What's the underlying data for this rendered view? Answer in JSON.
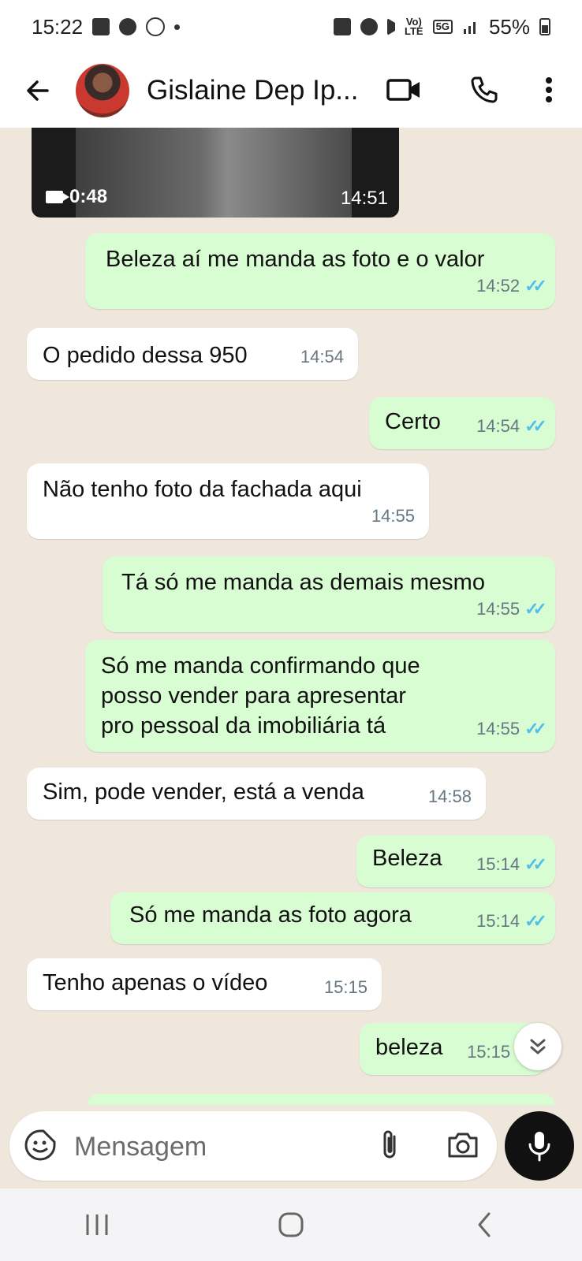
{
  "status_bar": {
    "time": "15:22",
    "network_top": "Vo)",
    "network_bottom": "LTE",
    "fiveg": "5G",
    "battery": "55%"
  },
  "header": {
    "contact_name": "Gislaine Dep Ip..."
  },
  "video_message": {
    "duration": "0:48",
    "time": "14:51"
  },
  "messages": [
    {
      "direction": "out",
      "text": "Beleza aí me manda as foto e o valor",
      "time": "14:52",
      "read": true
    },
    {
      "direction": "in",
      "text": "O pedido dessa 950",
      "time": "14:54"
    },
    {
      "direction": "out",
      "text": "Certo",
      "time": "14:54",
      "read": true
    },
    {
      "direction": "in",
      "text": "Não tenho foto da fachada aqui",
      "time": "14:55"
    },
    {
      "direction": "out",
      "text": "Tá só me manda as demais mesmo",
      "time": "14:55",
      "read": true
    },
    {
      "direction": "out",
      "text": "Só me manda confirmando que posso vender para apresentar pro pessoal da imobiliária tá",
      "time": "14:55",
      "read": true
    },
    {
      "direction": "in",
      "text": "Sim, pode vender, está a venda",
      "time": "14:58"
    },
    {
      "direction": "out",
      "text": "Beleza",
      "time": "15:14",
      "read": true
    },
    {
      "direction": "out",
      "text": "Só me manda as foto agora",
      "time": "15:14",
      "read": true
    },
    {
      "direction": "in",
      "text": "Tenho apenas o vídeo",
      "time": "15:15"
    },
    {
      "direction": "out",
      "text": "beleza",
      "time": "15:15",
      "read": true
    }
  ],
  "composer": {
    "placeholder": "Mensagem"
  },
  "colors": {
    "outgoing_bubble": "#d9fdd3",
    "incoming_bubble": "#ffffff",
    "read_ticks": "#53bdeb",
    "chat_background": "#efe7dc"
  },
  "icons": [
    "back-arrow-icon",
    "video-call-icon",
    "phone-icon",
    "more-options-icon",
    "sticker-icon",
    "attach-icon",
    "camera-icon",
    "mic-icon",
    "scroll-down-icon"
  ]
}
